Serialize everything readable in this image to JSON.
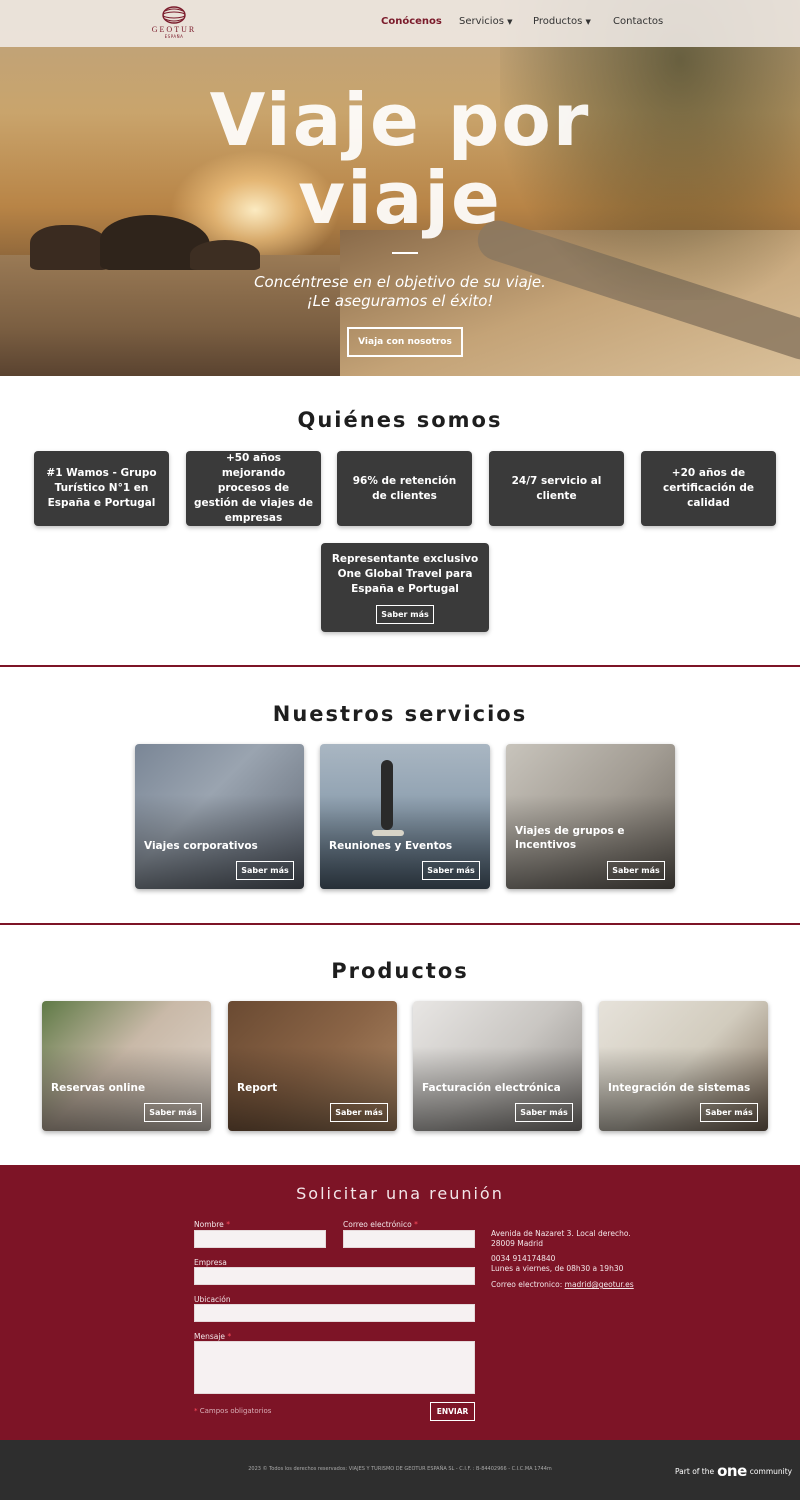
{
  "nav": {
    "logo_name": "GEOTUR",
    "logo_sub": "ESPAÑA",
    "items": [
      {
        "label": "Conócenos"
      },
      {
        "label": "Servicios"
      },
      {
        "label": "Productos"
      },
      {
        "label": "Contactos"
      }
    ]
  },
  "hero": {
    "title_line1": "Viaje por",
    "title_line2": "viaje",
    "subtitle_line1": "Concéntrese en el objetivo de su viaje.",
    "subtitle_line2": "¡Le aseguramos el éxito!",
    "button": "Viaja con nosotros"
  },
  "about": {
    "title": "Quiénes somos",
    "cards": [
      {
        "text": "#1 Wamos - Grupo Turístico N°1 en España e Portugal"
      },
      {
        "text": "+50 años mejorando procesos de gestión de viajes de empresas"
      },
      {
        "text": "96% de retención de clientes"
      },
      {
        "text": "24/7 servicio al cliente"
      },
      {
        "text": "+20 años de certificación de calidad"
      },
      {
        "text": "Representante exclusivo One Global Travel para España e Portugal",
        "button": "Saber más"
      }
    ]
  },
  "services": {
    "title": "Nuestros servicios",
    "items": [
      {
        "label": "Viajes corporativos",
        "button": "Saber más"
      },
      {
        "label": "Reuniones y Eventos",
        "button": "Saber más"
      },
      {
        "label": "Viajes de grupos e Incentivos",
        "button": "Saber más"
      }
    ]
  },
  "products": {
    "title": "Productos",
    "items": [
      {
        "label": "Reservas online",
        "button": "Saber más"
      },
      {
        "label": "Report",
        "button": "Saber más"
      },
      {
        "label": "Facturación electrónica",
        "button": "Saber más"
      },
      {
        "label": "Integración de sistemas",
        "button": "Saber más"
      }
    ]
  },
  "contact": {
    "title": "Solicitar una reunión",
    "fields": {
      "name": {
        "label": "Nombre",
        "value": ""
      },
      "email": {
        "label": "Correo electrónico",
        "value": ""
      },
      "company": {
        "label": "Empresa",
        "value": ""
      },
      "location": {
        "label": "Ubicación",
        "value": ""
      },
      "message": {
        "label": "Mensaje",
        "value": ""
      }
    },
    "required_note": "Campos obligatorios",
    "send": "ENVIAR",
    "address_line1": "Avenida de Nazaret 3. Local derecho.",
    "address_line2": "28009 Madrid",
    "phone": "0034 914174840",
    "hours": "Lunes a viernes, de 08h30 a 19h30",
    "email_label": "Correo electronico:",
    "email_value": "madrid@geotur.es"
  },
  "footer": {
    "copyright": "2023 © Todos los derechos reservados: VIAJES Y TURISMO DE GEOTUR ESPAÑA SL - C.I.F. : B-84402966 - C.I.C.MA 1744m",
    "part_of_prefix": "Part of the",
    "one_logo": "one",
    "part_of_suffix": "community"
  },
  "colors": {
    "brand": "#7d1426",
    "card_dark": "#3a3a3a",
    "footer": "#2e2e2e"
  }
}
